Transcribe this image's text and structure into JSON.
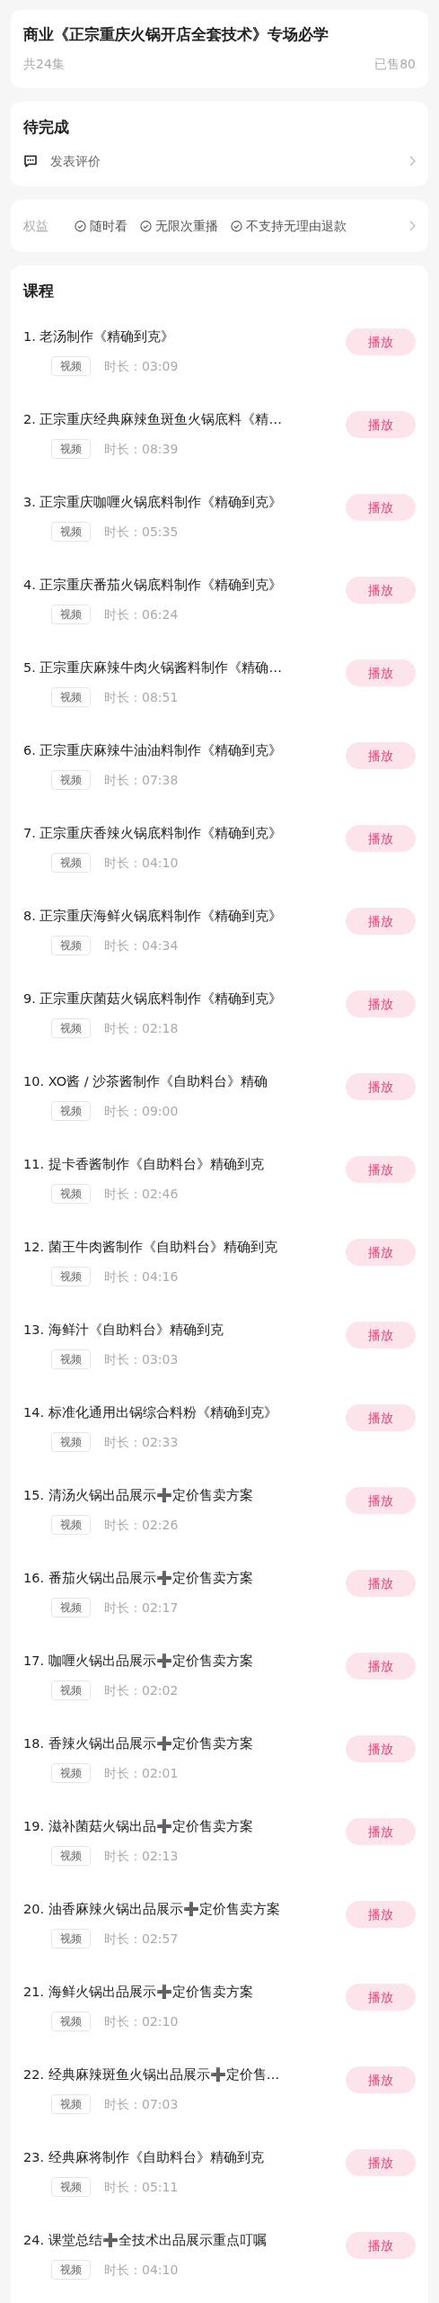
{
  "course": {
    "title": "商业《正宗重庆火锅开店全套技术》专场必学",
    "episodes": "共24集",
    "sold": "已售80"
  },
  "todo": {
    "heading": "待完成",
    "action": "发表评价"
  },
  "benefits": {
    "label": "权益",
    "items": [
      "随时看",
      "无限次重播",
      "不支持无理由退款"
    ]
  },
  "lessons_heading": "课程",
  "lessons": [
    {
      "title": "1. 老汤制作《精确到克》",
      "tag": "视频",
      "duration": "时长：03:09",
      "button": "播放"
    },
    {
      "title": "2. 正宗重庆经典麻辣鱼斑鱼火锅底料《精…",
      "tag": "视频",
      "duration": "时长：08:39",
      "button": "播放"
    },
    {
      "title": "3. 正宗重庆咖喱火锅底料制作《精确到克》",
      "tag": "视频",
      "duration": "时长：05:35",
      "button": "播放"
    },
    {
      "title": "4. 正宗重庆番茄火锅底料制作《精确到克》",
      "tag": "视频",
      "duration": "时长：06:24",
      "button": "播放"
    },
    {
      "title": "5. 正宗重庆麻辣牛肉火锅酱料制作《精确…",
      "tag": "视频",
      "duration": "时长：08:51",
      "button": "播放"
    },
    {
      "title": "6. 正宗重庆麻辣牛油油料制作《精确到克》",
      "tag": "视频",
      "duration": "时长：07:38",
      "button": "播放"
    },
    {
      "title": "7. 正宗重庆香辣火锅底料制作《精确到克》",
      "tag": "视频",
      "duration": "时长：04:10",
      "button": "播放"
    },
    {
      "title": "8. 正宗重庆海鲜火锅底料制作《精确到克》",
      "tag": "视频",
      "duration": "时长：04:34",
      "button": "播放"
    },
    {
      "title": "9. 正宗重庆菌菇火锅底料制作《精确到克》",
      "tag": "视频",
      "duration": "时长：02:18",
      "button": "播放"
    },
    {
      "title": "10. XO酱 / 沙茶酱制作《自助料台》精确",
      "tag": "视频",
      "duration": "时长：09:00",
      "button": "播放"
    },
    {
      "title": "11. 提卡香酱制作《自助料台》精确到克",
      "tag": "视频",
      "duration": "时长：02:46",
      "button": "播放"
    },
    {
      "title": "12. 菌王牛肉酱制作《自助料台》精确到克",
      "tag": "视频",
      "duration": "时长：04:16",
      "button": "播放"
    },
    {
      "title": "13. 海鲜汁《自助料台》精确到克",
      "tag": "视频",
      "duration": "时长：03:03",
      "button": "播放"
    },
    {
      "title": "14. 标准化通用出锅综合料粉《精确到克》",
      "tag": "视频",
      "duration": "时长：02:33",
      "button": "播放"
    },
    {
      "title": "15. 清汤火锅出品展示➕定价售卖方案",
      "tag": "视频",
      "duration": "时长：02:26",
      "button": "播放"
    },
    {
      "title": "16. 番茄火锅出品展示➕定价售卖方案",
      "tag": "视频",
      "duration": "时长：02:17",
      "button": "播放"
    },
    {
      "title": "17. 咖喱火锅出品展示➕定价售卖方案",
      "tag": "视频",
      "duration": "时长：02:02",
      "button": "播放"
    },
    {
      "title": "18. 香辣火锅出品展示➕定价售卖方案",
      "tag": "视频",
      "duration": "时长：02:01",
      "button": "播放"
    },
    {
      "title": "19. 滋补菌菇火锅出品➕定价售卖方案",
      "tag": "视频",
      "duration": "时长：02:13",
      "button": "播放"
    },
    {
      "title": "20. 油香麻辣火锅出品展示➕定价售卖方案",
      "tag": "视频",
      "duration": "时长：02:57",
      "button": "播放"
    },
    {
      "title": "21. 海鲜火锅出品展示➕定价售卖方案",
      "tag": "视频",
      "duration": "时长：02:10",
      "button": "播放"
    },
    {
      "title": "22. 经典麻辣斑鱼火锅出品展示➕定价售…",
      "tag": "视频",
      "duration": "时长：07:03",
      "button": "播放"
    },
    {
      "title": "23. 经典麻将制作《自助料台》精确到克",
      "tag": "视频",
      "duration": "时长：05:11",
      "button": "播放"
    },
    {
      "title": "24. 课堂总结➕全技术出品展示重点叮嘱",
      "tag": "视频",
      "duration": "时长：04:10",
      "button": "播放"
    }
  ]
}
